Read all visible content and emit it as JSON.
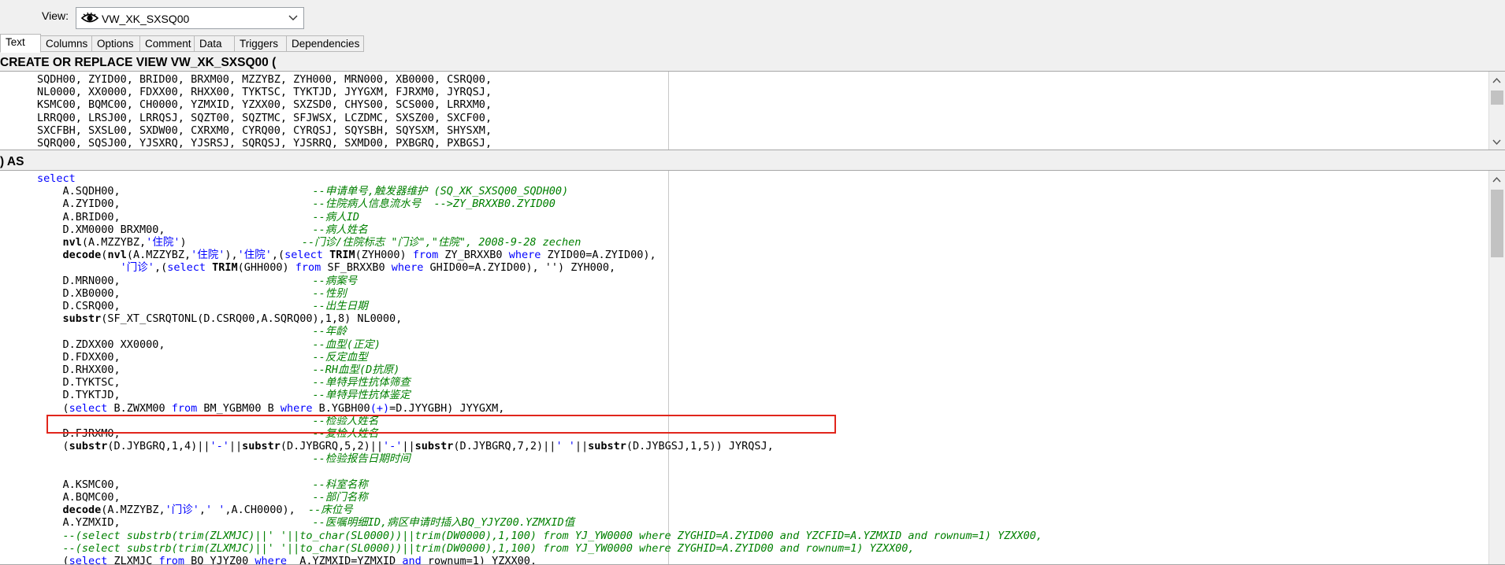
{
  "view_selector": {
    "label": "View:",
    "value": "VW_XK_SXSQ00",
    "icon": "eye-icon"
  },
  "tabs": [
    {
      "label": "Text",
      "active": true
    },
    {
      "label": "Columns"
    },
    {
      "label": "Options"
    },
    {
      "label": "Comment"
    },
    {
      "label": "Data"
    },
    {
      "label": "Triggers"
    },
    {
      "label": "Dependencies"
    }
  ],
  "header_pane": {
    "title": "CREATE OR REPLACE VIEW VW_XK_SXSQ00 (",
    "lines": [
      "SQDH00, ZYID00, BRID00, BRXM00, MZZYBZ, ZYH000, MRN000, XB0000, CSRQ00,",
      "NL0000, XX0000, FDXX00, RHXX00, TYKTSC, TYKTJD, JYYGXM, FJRXM0, JYRQSJ,",
      "KSMC00, BQMC00, CH0000, YZMXID, YZXX00, SXZSD0, CHYS00, SCS000, LRRXM0,",
      "LRRQ00, LRSJ00, LRRQSJ, SQZT00, SQZTMC, SFJWSX, LCZDMC, SXSZ00, SXCF00,",
      "SXCFBH, SXSL00, SXDW00, CXRXM0, CYRQ00, CYRQSJ, SQYSBH, SQYSXM, SHYSXM,",
      "SQRQ00, SQSJ00, YJSXRQ, YJSRSJ, SQRQSJ, YJSRRQ, SXMD00, PXBGRQ, PXBGSJ,"
    ]
  },
  "body_pane": {
    "title": ") AS",
    "lines": [
      [
        [
          "kw",
          "select"
        ]
      ],
      [
        [
          "t",
          "    A.SQDH00,                              "
        ],
        [
          "c",
          "--申请单号,触发器维护 (SQ_XK_SXSQ00_SQDH00)"
        ]
      ],
      [
        [
          "t",
          "    A.ZYID00,                              "
        ],
        [
          "c",
          "--住院病人信息流水号  -->ZY_BRXXB0.ZYID00"
        ]
      ],
      [
        [
          "t",
          "    A.BRID00,                              "
        ],
        [
          "c",
          "--病人ID"
        ]
      ],
      [
        [
          "t",
          "    D.XM0000 BRXM00,                       "
        ],
        [
          "c",
          "--病人姓名"
        ]
      ],
      [
        [
          "t",
          "    "
        ],
        [
          "f",
          "nvl"
        ],
        [
          "t",
          "(A.MZZYBZ,"
        ],
        [
          "s",
          "'住院'"
        ],
        [
          "t",
          ")                  "
        ],
        [
          "c",
          "--门诊/住院标志 \"门诊\",\"住院\", 2008-9-28 zechen"
        ]
      ],
      [
        [
          "t",
          "    "
        ],
        [
          "f",
          "decode"
        ],
        [
          "t",
          "("
        ],
        [
          "f",
          "nvl"
        ],
        [
          "t",
          "(A.MZZYBZ,"
        ],
        [
          "s",
          "'住院'"
        ],
        [
          "t",
          "),"
        ],
        [
          "s",
          "'住院'"
        ],
        [
          "t",
          ",("
        ],
        [
          "k",
          "select"
        ],
        [
          "t",
          " "
        ],
        [
          "f",
          "TRIM"
        ],
        [
          "t",
          "(ZYH000) "
        ],
        [
          "k",
          "from"
        ],
        [
          "t",
          " ZY_BRXXB0 "
        ],
        [
          "k",
          "where"
        ],
        [
          "t",
          " ZYID00=A.ZYID00),"
        ]
      ],
      [
        [
          "t",
          "             "
        ],
        [
          "s",
          "'门诊'"
        ],
        [
          "t",
          ",("
        ],
        [
          "k",
          "select"
        ],
        [
          "t",
          " "
        ],
        [
          "f",
          "TRIM"
        ],
        [
          "t",
          "(GHH000) "
        ],
        [
          "k",
          "from"
        ],
        [
          "t",
          " SF_BRXXB0 "
        ],
        [
          "k",
          "where"
        ],
        [
          "t",
          " GHID00=A.ZYID00), '') ZYH000,"
        ]
      ],
      [
        [
          "t",
          "    D.MRN000,                              "
        ],
        [
          "c",
          "--病案号"
        ]
      ],
      [
        [
          "t",
          "    D.XB0000,                              "
        ],
        [
          "c",
          "--性别"
        ]
      ],
      [
        [
          "t",
          "    D.CSRQ00,                              "
        ],
        [
          "c",
          "--出生日期"
        ]
      ],
      [
        [
          "t",
          "    "
        ],
        [
          "f",
          "substr"
        ],
        [
          "t",
          "(SF_XT_CSRQTONL(D.CSRQ00,A.SQRQ00),1,8) NL0000,"
        ]
      ],
      [
        [
          "t",
          "                                           "
        ],
        [
          "c",
          "--年龄"
        ]
      ],
      [
        [
          "t",
          "    D.ZDXX00 XX0000,                       "
        ],
        [
          "c",
          "--血型(正定)"
        ]
      ],
      [
        [
          "t",
          "    D.FDXX00,                              "
        ],
        [
          "c",
          "--反定血型"
        ]
      ],
      [
        [
          "t",
          "    D.RHXX00,                              "
        ],
        [
          "c",
          "--RH血型(D抗原)"
        ]
      ],
      [
        [
          "t",
          "    D.TYKTSC,                              "
        ],
        [
          "c",
          "--单特异性抗体筛查"
        ]
      ],
      [
        [
          "t",
          "    D.TYKTJD,                              "
        ],
        [
          "c",
          "--单特异性抗体鉴定"
        ]
      ],
      [
        [
          "t",
          "    ("
        ],
        [
          "k",
          "select"
        ],
        [
          "t",
          " B.ZWXM00 "
        ],
        [
          "k",
          "from"
        ],
        [
          "t",
          " BM_YGBM00 B "
        ],
        [
          "k",
          "where"
        ],
        [
          "t",
          " B.YGBH00"
        ],
        [
          "s",
          "(+)"
        ],
        [
          "t",
          "=D.JYYGBH) JYYGXM,"
        ]
      ],
      [
        [
          "t",
          "                                           "
        ],
        [
          "c",
          "--检验人姓名"
        ]
      ],
      [
        [
          "t",
          "    D.FJRXM0,                              "
        ],
        [
          "c",
          "--复检人姓名"
        ]
      ],
      [
        [
          "t",
          "    ("
        ],
        [
          "f",
          "substr"
        ],
        [
          "t",
          "(D.JYBGRQ,1,4)||"
        ],
        [
          "s",
          "'-'"
        ],
        [
          "t",
          "||"
        ],
        [
          "f",
          "substr"
        ],
        [
          "t",
          "(D.JYBGRQ,5,2)||"
        ],
        [
          "s",
          "'-'"
        ],
        [
          "t",
          "||"
        ],
        [
          "f",
          "substr"
        ],
        [
          "t",
          "(D.JYBGRQ,7,2)||"
        ],
        [
          "s",
          "' '"
        ],
        [
          "t",
          "||"
        ],
        [
          "f",
          "substr"
        ],
        [
          "t",
          "(D.JYBGSJ,1,5)) JYRQSJ,"
        ]
      ],
      [
        [
          "t",
          "                                           "
        ],
        [
          "c",
          "--检验报告日期时间"
        ]
      ],
      [
        [
          "t",
          ""
        ]
      ],
      [
        [
          "t",
          "    A.KSMC00,                              "
        ],
        [
          "c",
          "--科室名称"
        ]
      ],
      [
        [
          "t",
          "    A.BQMC00,                              "
        ],
        [
          "c",
          "--部门名称"
        ]
      ],
      [
        [
          "t",
          "    "
        ],
        [
          "f",
          "decode"
        ],
        [
          "t",
          "(A.MZZYBZ,"
        ],
        [
          "s",
          "'门诊'"
        ],
        [
          "t",
          ","
        ],
        [
          "s",
          "' '"
        ],
        [
          "t",
          ",A.CH0000),  "
        ],
        [
          "c",
          "--床位号"
        ]
      ],
      [
        [
          "t",
          "    A.YZMXID,                              "
        ],
        [
          "c",
          "--医嘱明细ID,病区申请时插入BQ_YJYZ00.YZMXID值"
        ]
      ],
      [
        [
          "c",
          "    --(select substrb(trim(ZLXMJC)||' '||to_char(SL0000))||trim(DW0000),1,100) from YJ_YW0000 where ZYGHID=A.ZYID00 and YZCFID=A.YZMXID and rownum=1) YZXX00,"
        ]
      ],
      [
        [
          "c",
          "    --(select substrb(trim(ZLXMJC)||' '||to_char(SL0000))||trim(DW0000),1,100) from YJ_YW0000 where ZYGHID=A.ZYID00 and rownum=1) YZXX00,"
        ]
      ],
      [
        [
          "t",
          "    ("
        ],
        [
          "k",
          "select"
        ],
        [
          "t",
          " ZLXMJC "
        ],
        [
          "k",
          "from"
        ],
        [
          "t",
          " BQ_YJYZ00 "
        ],
        [
          "k",
          "where"
        ],
        [
          "t",
          "  A.YZMXID=YZMXID "
        ],
        [
          "k",
          "and"
        ],
        [
          "t",
          " rownum=1) YZXX00,"
        ]
      ]
    ]
  }
}
